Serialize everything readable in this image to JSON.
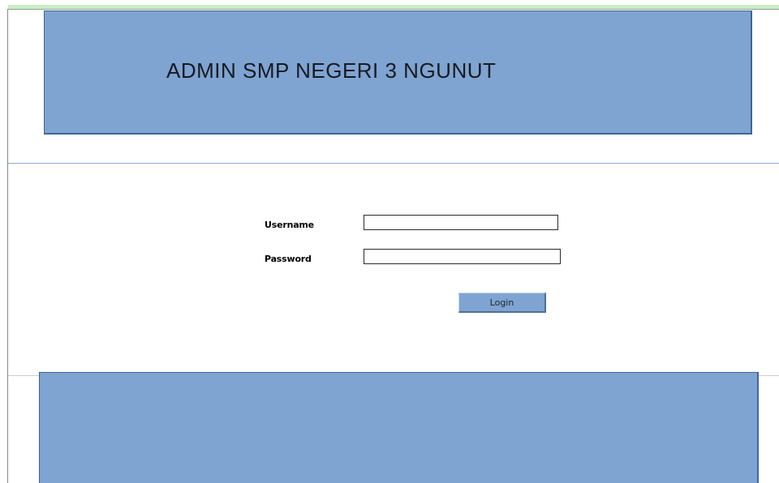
{
  "header": {
    "title": "ADMIN SMP NEGERI 3 NGUNUT"
  },
  "login_form": {
    "username_label": "Username",
    "username_value": "",
    "password_label": "Password",
    "password_value": "",
    "login_button_label": "Login"
  },
  "colors": {
    "banner_fill": "#7fa4d1",
    "banner_border": "#3f6596",
    "top_strip": "#c8eec6"
  }
}
